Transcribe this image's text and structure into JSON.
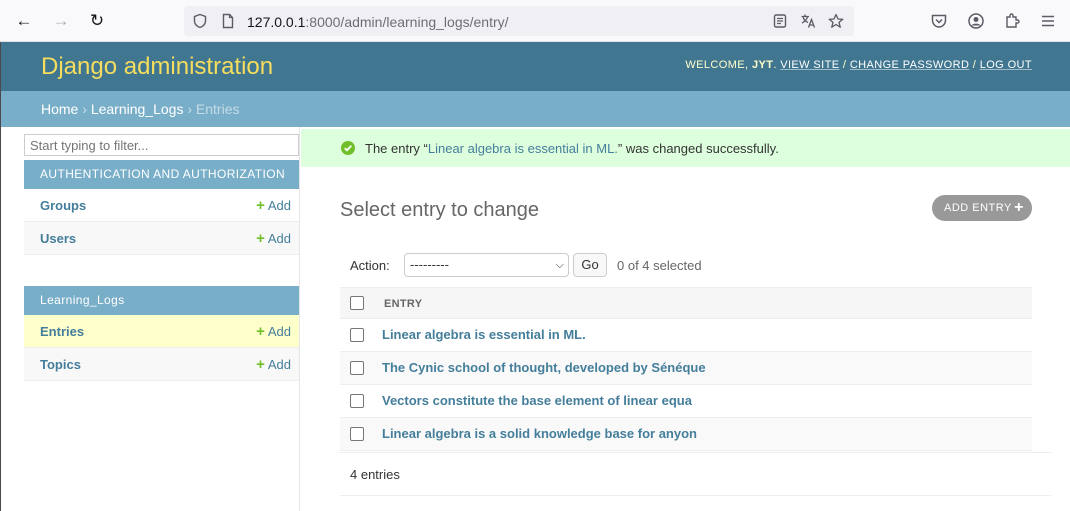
{
  "browser": {
    "url_host": "127.0.0.1",
    "url_rest": ":8000/admin/learning_logs/entry/"
  },
  "header": {
    "branding": "Django administration",
    "welcome": "Welcome,",
    "user": "JYT",
    "view_site": "View site",
    "change_password": "Change password",
    "log_out": "Log out"
  },
  "breadcrumbs": {
    "home": "Home",
    "app": "Learning_Logs",
    "current": "Entries",
    "sep": "›"
  },
  "sidebar": {
    "filter_placeholder": "Start typing to filter...",
    "modules": [
      {
        "caption": "Authentication and Authorization",
        "models": [
          {
            "name": "Groups",
            "add": "Add"
          },
          {
            "name": "Users",
            "add": "Add"
          }
        ]
      },
      {
        "caption": "Learning_Logs",
        "models": [
          {
            "name": "Entries",
            "add": "Add"
          },
          {
            "name": "Topics",
            "add": "Add"
          }
        ]
      }
    ]
  },
  "message": {
    "prefix": "The entry “",
    "link": "Linear algebra is essential in ML.",
    "suffix": "” was changed successfully."
  },
  "main": {
    "title": "Select entry to change",
    "add_button": "Add entry",
    "action_label": "Action:",
    "action_selected": "---------",
    "go": "Go",
    "counter": "0 of 4 selected",
    "column_header": "Entry",
    "rows": [
      "Linear algebra is essential in ML.",
      "The Cynic school of thought, developed by Sénéque",
      "Vectors constitute the base element of linear equa",
      "Linear algebra is a solid knowledge base for anyon"
    ],
    "paginator": "4 entries"
  },
  "colors": {
    "header_bg": "#417690",
    "branding": "#f5dd5d",
    "breadcrumb_bg": "#79aec8",
    "link": "#447e9b",
    "success_bg": "#ddffdd",
    "add_icon": "#70bf2b"
  }
}
